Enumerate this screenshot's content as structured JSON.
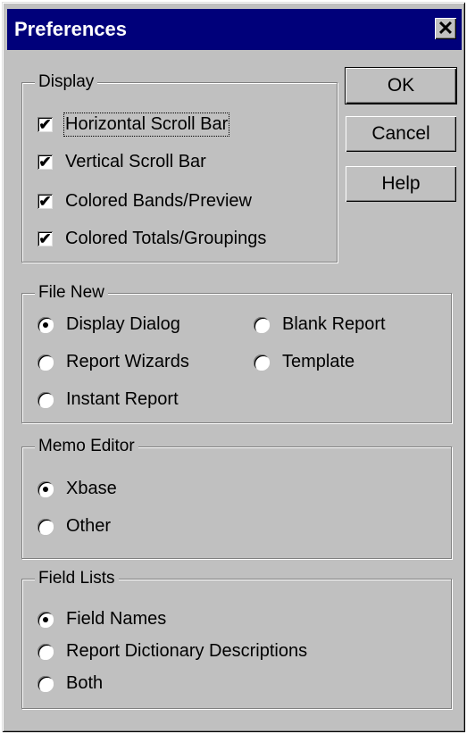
{
  "window": {
    "title": "Preferences",
    "close_glyph": "✕"
  },
  "buttons": {
    "ok": "OK",
    "cancel": "Cancel",
    "help": "Help"
  },
  "display": {
    "title": "Display",
    "items": [
      {
        "label": "Horizontal Scroll Bar",
        "checked": true
      },
      {
        "label": "Vertical Scroll Bar",
        "checked": true
      },
      {
        "label": "Colored Bands/Preview",
        "checked": true
      },
      {
        "label": "Colored Totals/Groupings",
        "checked": true
      }
    ]
  },
  "file_new": {
    "title": "File New",
    "options": [
      {
        "label": "Display Dialog",
        "selected": true
      },
      {
        "label": "Report Wizards",
        "selected": false
      },
      {
        "label": "Instant Report",
        "selected": false
      },
      {
        "label": "Blank Report",
        "selected": false
      },
      {
        "label": "Template",
        "selected": false
      }
    ]
  },
  "memo_editor": {
    "title": "Memo Editor",
    "options": [
      {
        "label": "Xbase",
        "selected": true
      },
      {
        "label": "Other",
        "selected": false
      }
    ]
  },
  "field_lists": {
    "title": "Field Lists",
    "options": [
      {
        "label": "Field Names",
        "selected": true
      },
      {
        "label": "Report Dictionary Descriptions",
        "selected": false
      },
      {
        "label": "Both",
        "selected": false
      }
    ]
  },
  "check_glyph": "✔"
}
